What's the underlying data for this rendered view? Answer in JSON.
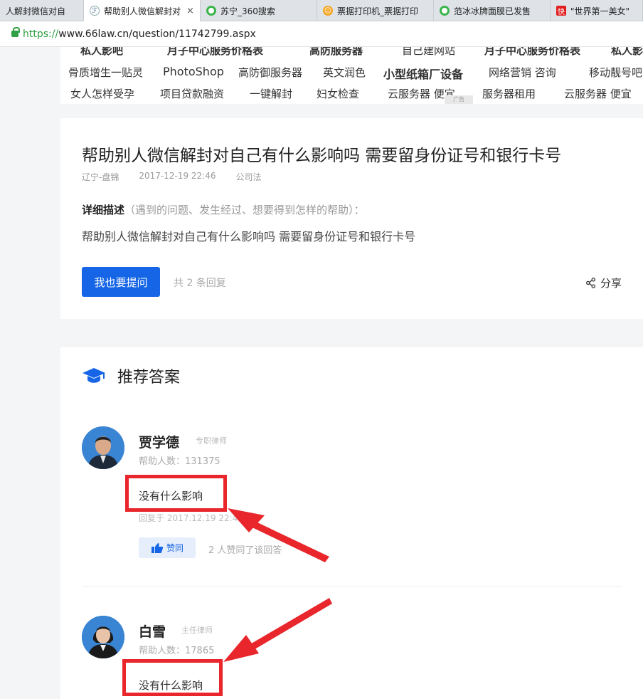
{
  "browser": {
    "tabs": [
      {
        "label": "人解封微信对自"
      },
      {
        "label": "帮助别人微信解封对"
      },
      {
        "label": "苏宁_360搜索"
      },
      {
        "label": "票据打印机_票据打印"
      },
      {
        "label": "范冰冰牌面膜已发售"
      },
      {
        "label": "\"世界第一美女\""
      }
    ],
    "tab_close": "×",
    "tab_icon_text": "快",
    "url_scheme": "https://",
    "url_rest": "www.66law.cn/question/11742799.aspx"
  },
  "ads": {
    "row0": [
      "私人影吧",
      "月子中心服务价格表",
      "高防服务器",
      "自己建网站",
      "月子中心服务价格表",
      "私人影"
    ],
    "row1": [
      "骨质增生一贴灵",
      "PhotoShop",
      "高防御服务器",
      "英文润色",
      "小型纸箱厂设备",
      "网络营销 咨询",
      "移动靓号吧"
    ],
    "row2": [
      "女人怎样受孕",
      "项目贷款融资",
      "一键解封",
      "妇女检查",
      "云服务器 便宜",
      "服务器租用",
      "云服务器 便宜"
    ],
    "badge": "广告"
  },
  "question": {
    "title": "帮助别人微信解封对自己有什么影响吗 需要留身份证号和银行卡号",
    "location": "辽宁-盘锦",
    "datetime": "2017-12-19 22:46",
    "category": "公司法",
    "desc_label": "详细描述",
    "desc_hint": "（遇到的问题、发生经过、想要得到怎样的帮助）：",
    "desc": "帮助别人微信解封对自己有什么影响吗 需要留身份证号和银行卡号",
    "ask_button": "我也要提问",
    "reply_count": "共 2 条回复",
    "share_label": "分享"
  },
  "answers_section": {
    "title": "推荐答案",
    "answers": [
      {
        "name": "贾学德",
        "role": "专职律师",
        "help_count": "帮助人数：131375",
        "text": "没有什么影响",
        "reply_date": "回复于 2017.12.19 22:49",
        "like_label": "赞同",
        "like_text": "2 人赞同了该回答"
      },
      {
        "name": "白雪",
        "role": "主任律师",
        "help_count": "帮助人数：17865",
        "text": "没有什么影响"
      }
    ]
  },
  "colors": {
    "accent": "#1565e6",
    "annotation_red": "#e8262c"
  }
}
